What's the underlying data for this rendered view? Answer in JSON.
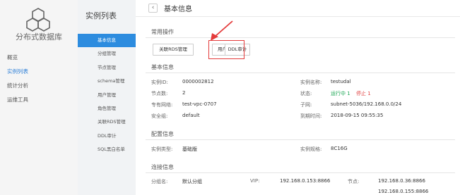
{
  "global_sidebar": {
    "brand": "分布式数据库",
    "items": [
      {
        "label": "概览"
      },
      {
        "label": "实例列表"
      },
      {
        "label": "统计分析"
      },
      {
        "label": "运维工具"
      }
    ]
  },
  "instance_sidebar": {
    "title": "实例列表",
    "items": [
      {
        "label": "基本信息"
      },
      {
        "label": "分组管理"
      },
      {
        "label": "节点管理"
      },
      {
        "label": "schema管理"
      },
      {
        "label": "用户管理"
      },
      {
        "label": "角色管理"
      },
      {
        "label": "关联RDS管理"
      },
      {
        "label": "DDL审计"
      },
      {
        "label": "SQL黑白名单"
      }
    ]
  },
  "header": {
    "back_icon": "‹",
    "title": "基本信息"
  },
  "common_ops": {
    "title": "常用操作",
    "buttons": [
      {
        "label": "关联RDS管理"
      },
      {
        "label": "用户管理"
      },
      {
        "label": "DDL审计"
      }
    ]
  },
  "basic_info": {
    "title": "基本信息",
    "instance_id": {
      "key": "实例ID:",
      "value": "0000002812"
    },
    "instance_name": {
      "key": "实例名称:",
      "value": "testudal"
    },
    "node_count": {
      "key": "节点数:",
      "value": "2"
    },
    "status": {
      "key": "状态:",
      "running": "运行中 1",
      "stopped": "停止 1"
    },
    "vpc": {
      "key": "专有网络:",
      "value": "test-vpc-0707"
    },
    "subnet": {
      "key": "子网:",
      "value": "subnet-5036/192.168.0.0/24"
    },
    "security_group": {
      "key": "安全组:",
      "value": "default"
    },
    "expire": {
      "key": "到期时间:",
      "value": "2018-09-15 09:55:35"
    }
  },
  "config_info": {
    "title": "配置信息",
    "type": {
      "key": "实例类型:",
      "value": "基础版"
    },
    "spec": {
      "key": "实例规格:",
      "value": "8C16G"
    }
  },
  "connection_info": {
    "title": "连接信息",
    "group": {
      "key": "分组名:",
      "value": "默认分组"
    },
    "vip": {
      "key": "VIP:",
      "value": "192.168.0.153:8866"
    },
    "nodes": {
      "key": "节点:",
      "values": [
        "192.168.0.36:8866",
        "192.168.0.155:8866"
      ]
    }
  },
  "colors": {
    "accent": "#2d8cdf",
    "highlight": "#e43b3b",
    "running": "#19a552",
    "stopped": "#e04343"
  }
}
